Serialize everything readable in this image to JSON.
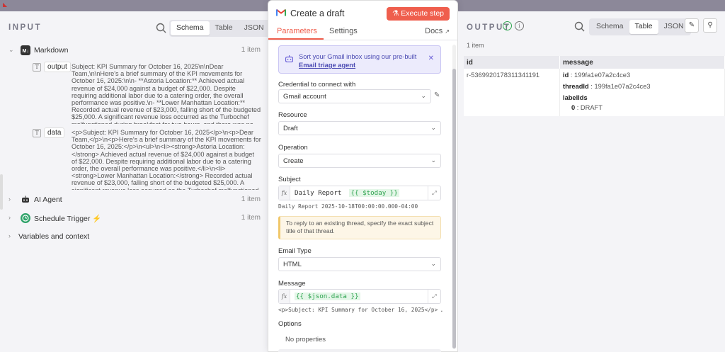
{
  "input": {
    "title": "INPUT",
    "view_tabs": [
      "Schema",
      "Table",
      "JSON"
    ],
    "active_view": "Schema",
    "nodes": [
      {
        "label": "Markdown",
        "count": "1 item",
        "expanded": true
      },
      {
        "label": "AI Agent",
        "count": "1 item"
      },
      {
        "label": "Schedule Trigger",
        "count": "1 item",
        "badge": "⚡"
      }
    ],
    "variables_label": "Variables and context",
    "fields": [
      {
        "key": "output",
        "value": "Subject: KPI Summary for October 16, 2025\\n\\nDear Team,\\n\\nHere's a brief summary of the KPI movements for October 16, 2025:\\n\\n- **Astoria Location:** Achieved actual revenue of $24,000 against a budget of $22,000. Despite requiring additional labor due to a catering order, the overall performance was positive.\\n- **Lower Manhattan Location:** Recorded actual revenue of $23,000, falling short of the budgeted $25,000. A significant revenue loss occurred as the Turbochef malfunctioned during breakfast for two hours, and there was no opportunity to reduce labor costs.\\n- **Hell's Kitchen Location:** Exp..."
      },
      {
        "key": "data",
        "value": "<p>Subject: KPI Summary for October 16, 2025</p>\\n<p>Dear Team,</p>\\n<p>Here's a brief summary of the KPI movements for October 16, 2025:</p>\\n<ul>\\n<li><strong>Astoria Location:</strong> Achieved actual revenue of $24,000 against a budget of $22,000. Despite requiring additional labor due to a catering order, the overall performance was positive.</li>\\n<li><strong>Lower Manhattan Location:</strong> Recorded actual revenue of $23,000, falling short of the budgeted $25,000. A significant revenue loss occurred as the Turbochef malfunctioned during breakfast for two hours, and there was no opportunity..."
      }
    ]
  },
  "node": {
    "title": "Create a draft",
    "execute_label": "Execute step",
    "tabs": [
      "Parameters",
      "Settings"
    ],
    "docs_label": "Docs",
    "notice_text": "Sort your Gmail inbox using our pre-built",
    "notice_link": "Email triage agent",
    "credential_label": "Credential to connect with",
    "credential_value": "Gmail account",
    "resource_label": "Resource",
    "resource_value": "Draft",
    "operation_label": "Operation",
    "operation_value": "Create",
    "subject_label": "Subject",
    "subject_static": "Daily Report",
    "subject_expr": "{{ $today }}",
    "subject_result": "Daily Report  2025-10-18T00:00:00.000-04:00",
    "hint_text": "To reply to an existing thread, specify the exact subject title of that thread.",
    "email_type_label": "Email Type",
    "email_type_value": "HTML",
    "message_label": "Message",
    "message_expr": "{{ $json.data }}",
    "message_result": "<p>Subject: KPI Summary for October 16, 2025</p> …",
    "options_label": "Options",
    "no_properties": "No properties"
  },
  "output": {
    "title": "OUTPUT",
    "view_tabs": [
      "Schema",
      "Table",
      "JSON"
    ],
    "active_view": "Table",
    "count": "1 item",
    "columns": [
      "id",
      "message"
    ],
    "row": {
      "id": "r-5369920178311341191",
      "message_id_key": "id",
      "message_id_val": ": 199fa1e07a2c4ce3",
      "thread_key": "threadId",
      "thread_val": ": 199fa1e07a2c4ce3",
      "labels_key": "labelIds",
      "label_index": "0",
      "label_val": ": DRAFT"
    }
  }
}
